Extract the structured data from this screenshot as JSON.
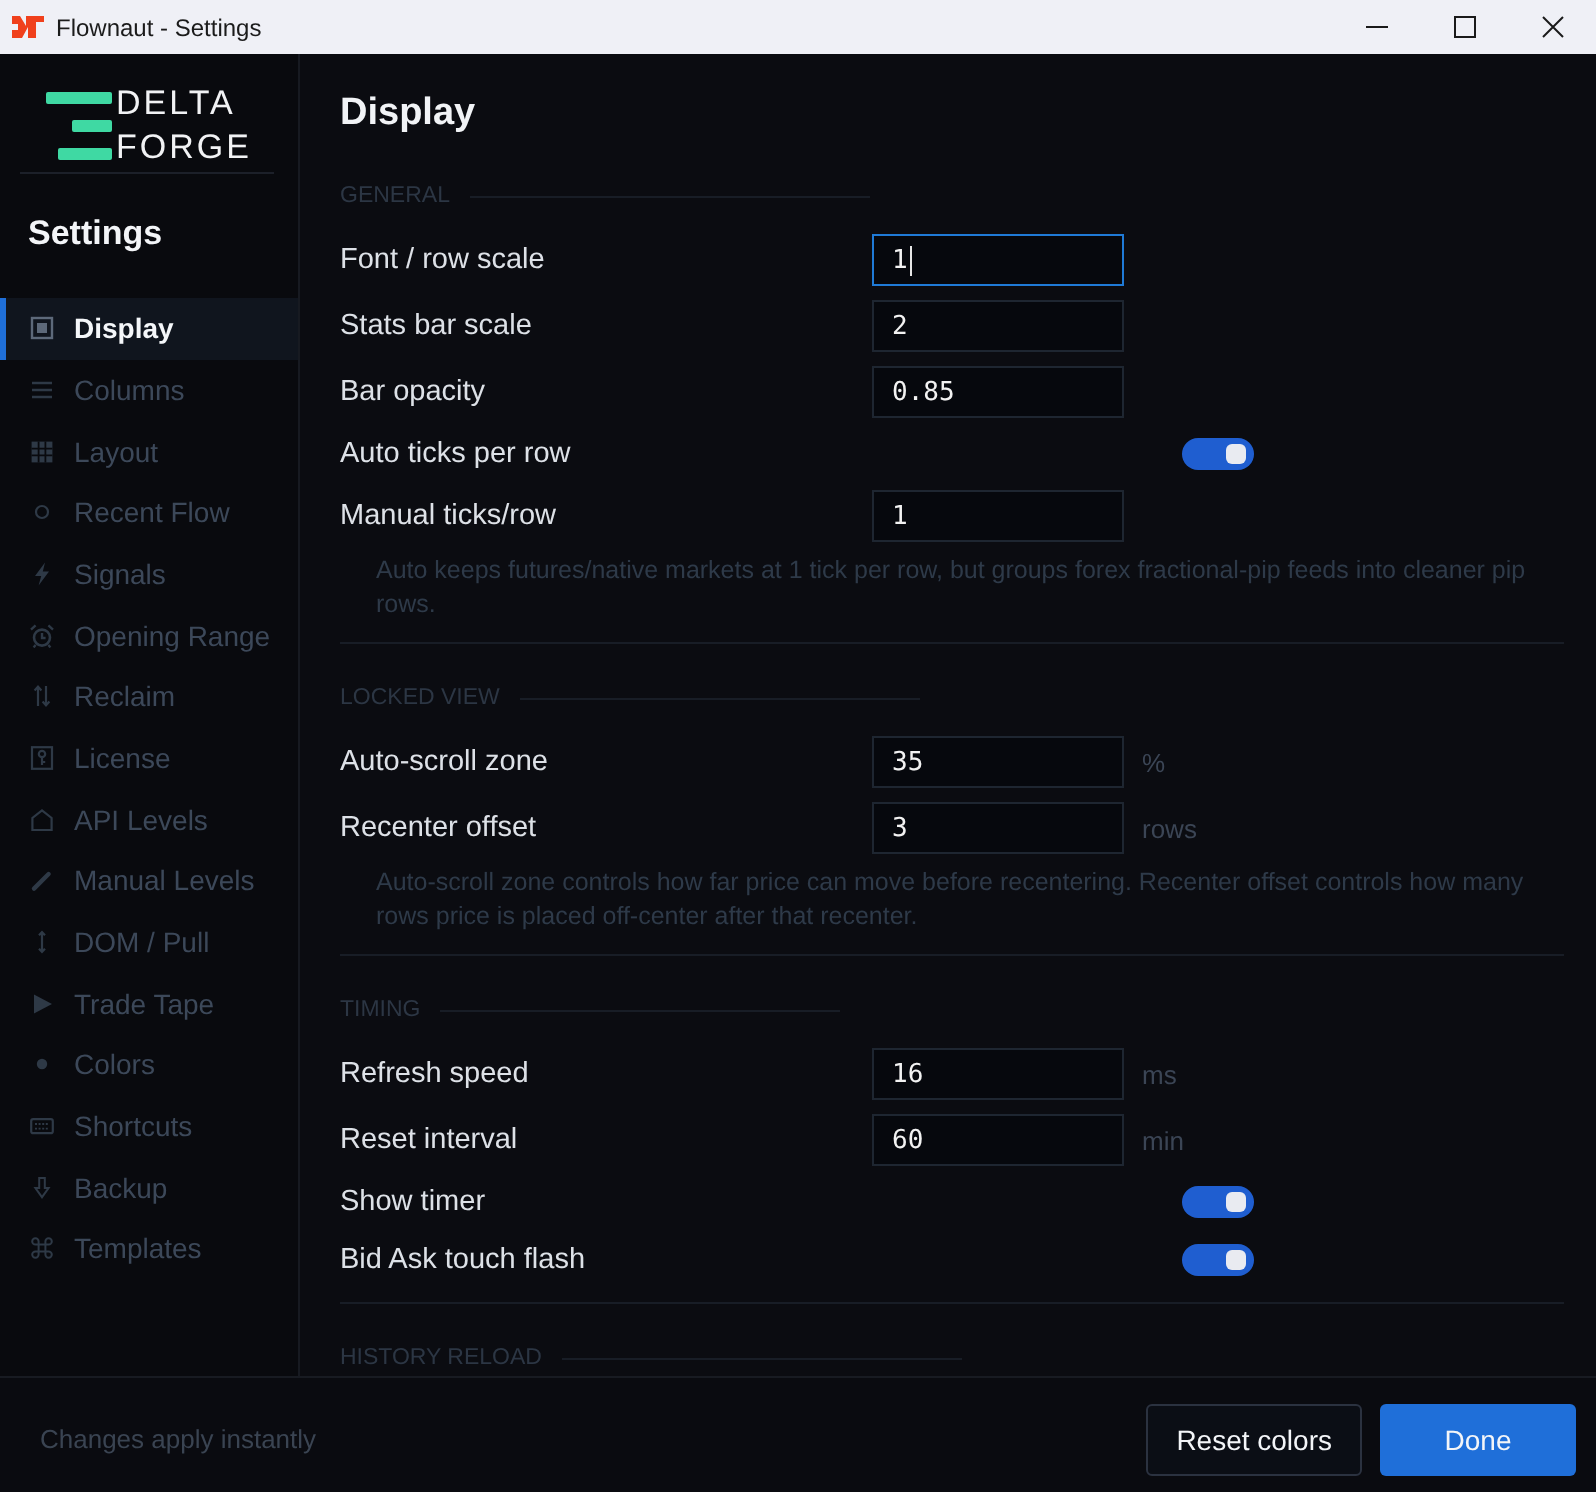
{
  "window": {
    "title": "Flownaut - Settings"
  },
  "sidebar": {
    "logo": {
      "lines": [
        "DELTA",
        "FORGE"
      ]
    },
    "heading": "Settings",
    "items": [
      {
        "label": "Display",
        "selected": true
      },
      {
        "label": "Columns",
        "selected": false
      },
      {
        "label": "Layout",
        "selected": false
      },
      {
        "label": "Recent Flow",
        "selected": false
      },
      {
        "label": "Signals",
        "selected": false
      },
      {
        "label": "Opening Range",
        "selected": false
      },
      {
        "label": "Reclaim",
        "selected": false
      },
      {
        "label": "License",
        "selected": false
      },
      {
        "label": "API Levels",
        "selected": false
      },
      {
        "label": "Manual Levels",
        "selected": false
      },
      {
        "label": "DOM / Pull",
        "selected": false
      },
      {
        "label": "Trade Tape",
        "selected": false
      },
      {
        "label": "Colors",
        "selected": false
      },
      {
        "label": "Shortcuts",
        "selected": false
      },
      {
        "label": "Backup",
        "selected": false
      },
      {
        "label": "Templates",
        "selected": false
      }
    ]
  },
  "page": {
    "title": "Display",
    "sections": [
      {
        "title": "GENERAL",
        "rows": [
          {
            "kind": "input",
            "label": "Font / row scale",
            "value": "1",
            "focused": true
          },
          {
            "kind": "input",
            "label": "Stats bar scale",
            "value": "2",
            "focused": false
          },
          {
            "kind": "input",
            "label": "Bar opacity",
            "value": "0.85",
            "focused": false
          },
          {
            "kind": "toggle",
            "label": "Auto ticks per row",
            "on": true
          },
          {
            "kind": "input",
            "label": "Manual ticks/row",
            "value": "1",
            "focused": false
          }
        ],
        "hint": "Auto keeps futures/native markets at 1 tick per row, but groups forex fractional-pip feeds into cleaner pip rows."
      },
      {
        "title": "LOCKED VIEW",
        "rows": [
          {
            "kind": "input",
            "label": "Auto-scroll zone",
            "value": "35",
            "unit": "%",
            "focused": false
          },
          {
            "kind": "input",
            "label": "Recenter offset",
            "value": "3",
            "unit": "rows",
            "focused": false
          }
        ],
        "hint": "Auto-scroll zone controls how far price can move before recentering. Recenter offset controls how many rows price is placed off-center after that recenter."
      },
      {
        "title": "TIMING",
        "rows": [
          {
            "kind": "input",
            "label": "Refresh speed",
            "value": "16",
            "unit": "ms",
            "focused": false
          },
          {
            "kind": "input",
            "label": "Reset interval",
            "value": "60",
            "unit": "min",
            "focused": false
          },
          {
            "kind": "toggle",
            "label": "Show timer",
            "on": true
          },
          {
            "kind": "toggle",
            "label": "Bid Ask touch flash",
            "on": true
          }
        ]
      },
      {
        "title": "HISTORY RELOAD"
      }
    ]
  },
  "footer": {
    "note": "Changes apply instantly",
    "buttons": [
      {
        "label": "Reset colors",
        "kind": "secondary"
      },
      {
        "label": "Done",
        "kind": "primary"
      }
    ]
  }
}
